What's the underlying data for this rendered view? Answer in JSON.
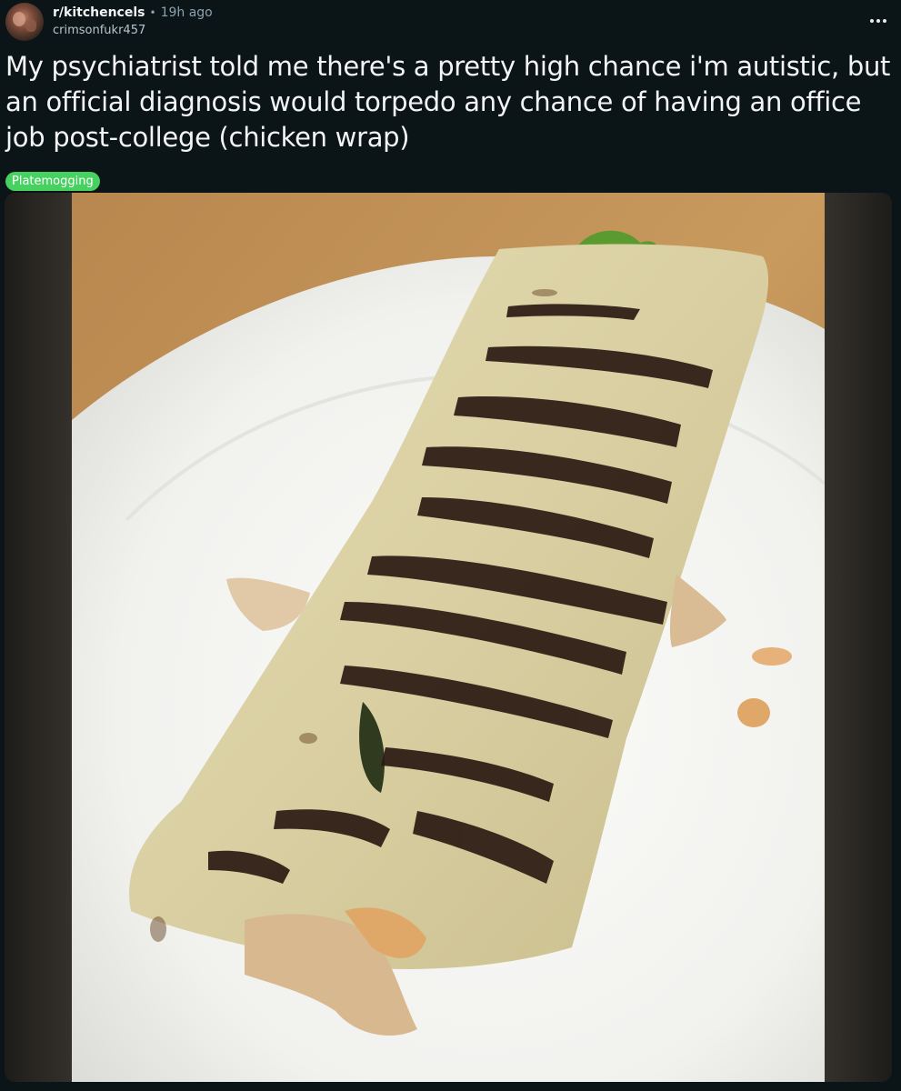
{
  "post": {
    "subreddit": "r/kitchencels",
    "separator": "•",
    "time": "19h ago",
    "author": "crimsonfukr457",
    "title": "My psychiatrist told me there's a pretty high chance i'm autistic, but an official diagnosis would torpedo any chance of having an office job post-college (chicken wrap)",
    "flair": "Platemogging",
    "flair_color": "#46d160",
    "more_icon": "ellipsis-icon"
  },
  "colors": {
    "background": "#0b1416",
    "text": "#f2f4f5",
    "muted": "#8ba2ad"
  }
}
